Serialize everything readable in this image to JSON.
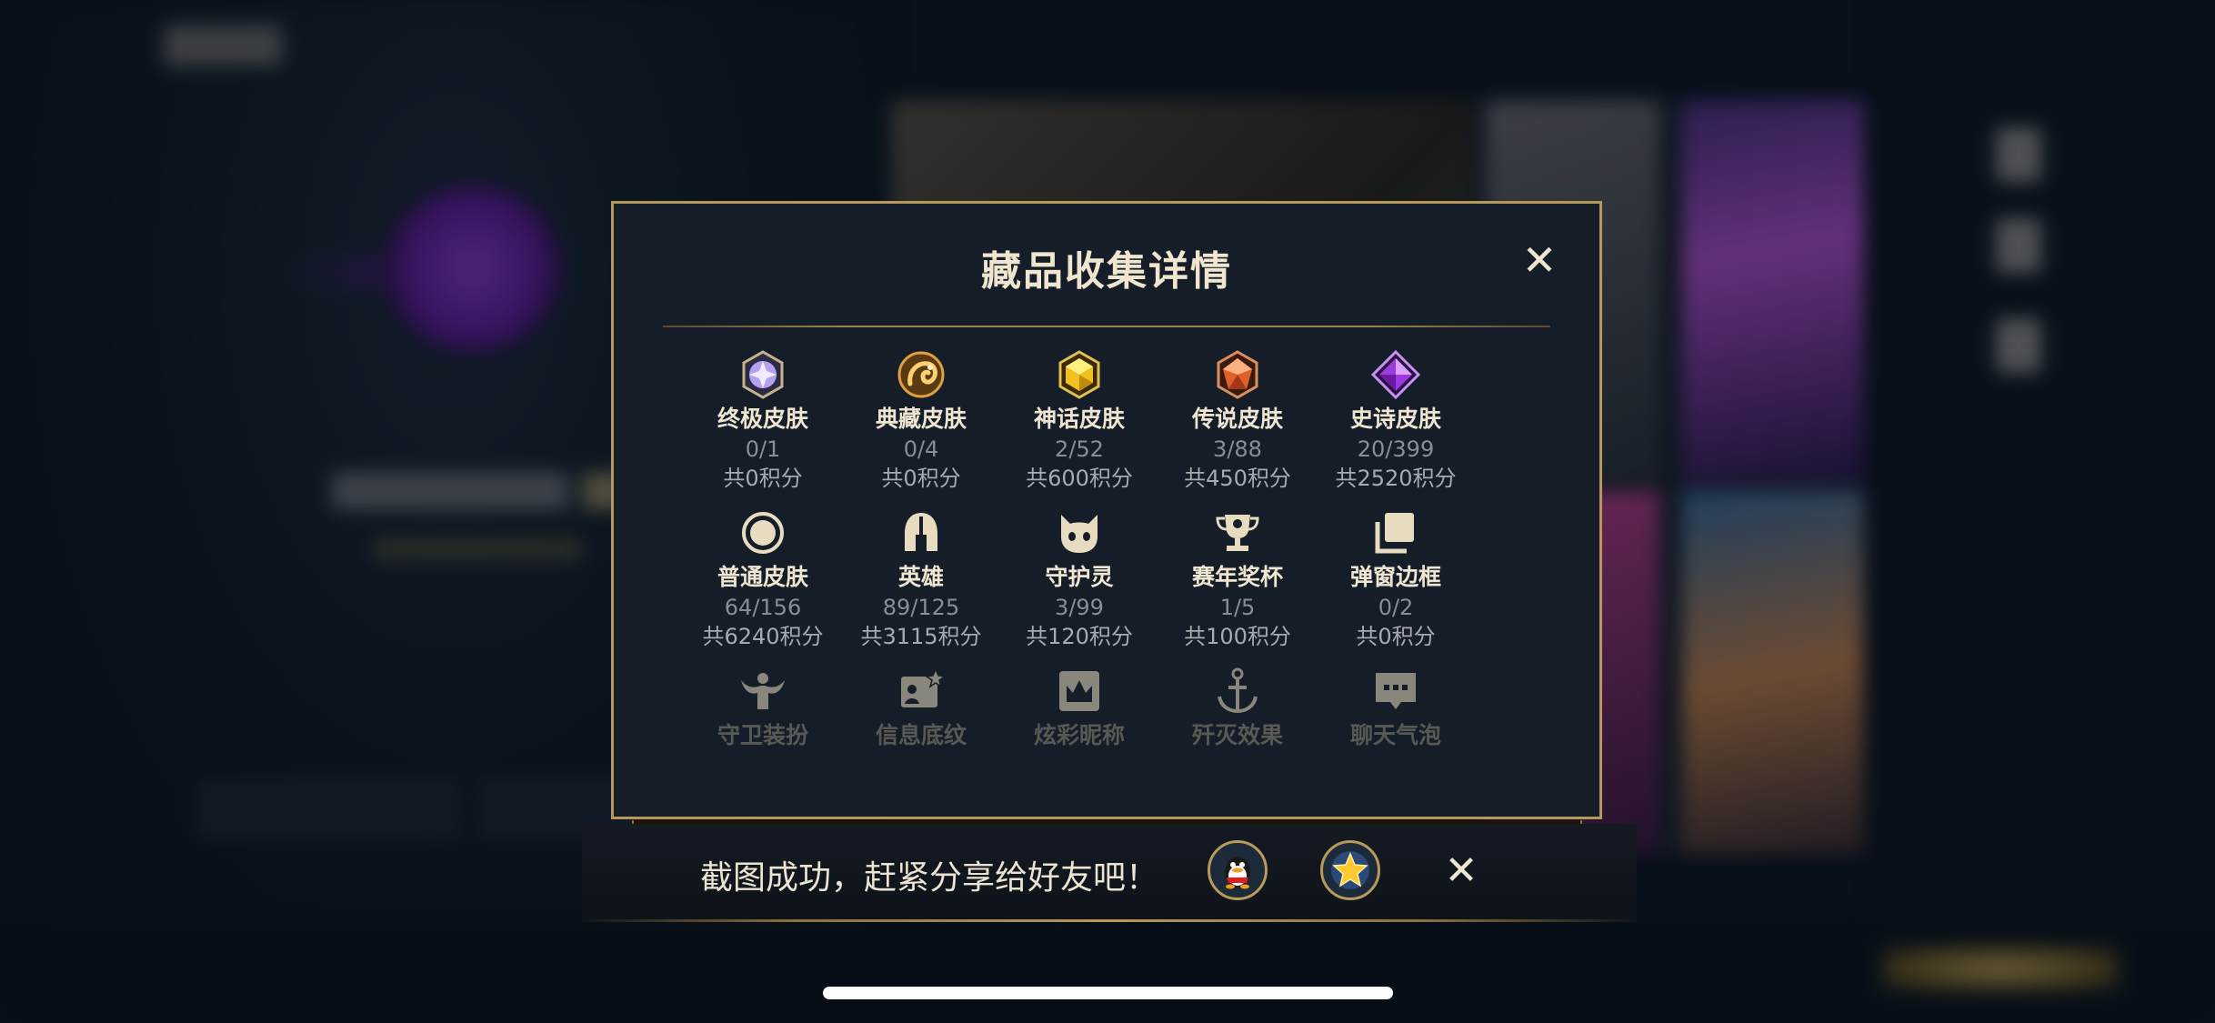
{
  "modal": {
    "title": "藏品收集详情"
  },
  "categories": [
    {
      "name": "终极皮肤",
      "count": "0/1",
      "points": "共0积分",
      "icon": "ultimate-skin-gem-icon"
    },
    {
      "name": "典藏皮肤",
      "count": "0/4",
      "points": "共0积分",
      "icon": "collection-skin-dragon-icon"
    },
    {
      "name": "神话皮肤",
      "count": "2/52",
      "points": "共600积分",
      "icon": "mythic-skin-gem-icon"
    },
    {
      "name": "传说皮肤",
      "count": "3/88",
      "points": "共450积分",
      "icon": "legendary-skin-gem-icon"
    },
    {
      "name": "史诗皮肤",
      "count": "20/399",
      "points": "共2520积分",
      "icon": "epic-skin-gem-icon"
    },
    {
      "name": "普通皮肤",
      "count": "64/156",
      "points": "共6240积分",
      "icon": "normal-skin-circle-icon"
    },
    {
      "name": "英雄",
      "count": "89/125",
      "points": "共3115积分",
      "icon": "hero-helmet-icon"
    },
    {
      "name": "守护灵",
      "count": "3/99",
      "points": "共120积分",
      "icon": "guardian-spirit-icon"
    },
    {
      "name": "赛年奖杯",
      "count": "1/5",
      "points": "共100积分",
      "icon": "season-trophy-icon"
    },
    {
      "name": "弹窗边框",
      "count": "0/2",
      "points": "共0积分",
      "icon": "popup-frame-icon"
    },
    {
      "name": "守卫装扮",
      "icon": "guard-outfit-icon"
    },
    {
      "name": "信息底纹",
      "icon": "info-background-icon"
    },
    {
      "name": "炫彩昵称",
      "icon": "colorful-nickname-icon"
    },
    {
      "name": "歼灭效果",
      "icon": "annihilation-effect-icon"
    },
    {
      "name": "聊天气泡",
      "icon": "chat-bubble-icon"
    }
  ],
  "share": {
    "message": "截图成功，赶紧分享给好友吧！",
    "qq_icon": "qq-share-icon",
    "favorite_icon": "star-share-icon"
  },
  "colors": {
    "gold_border": "#b8975a",
    "modal_bg": "#151d28",
    "text_primary": "#efe6d2",
    "text_muted": "#8a8e94"
  }
}
